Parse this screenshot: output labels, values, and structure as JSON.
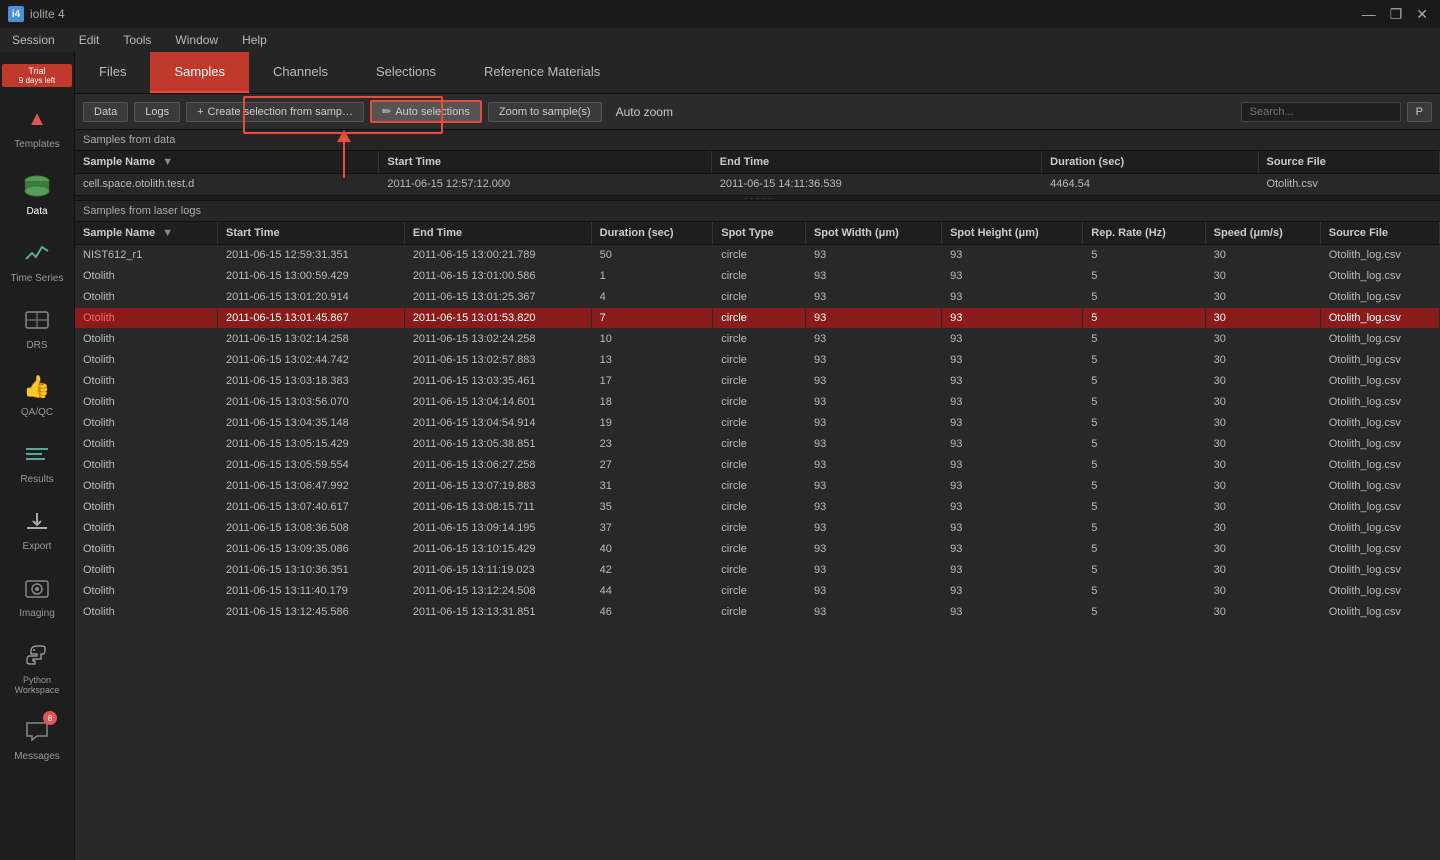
{
  "app": {
    "title": "iolite 4",
    "icon": "i4"
  },
  "titlebar": {
    "controls": [
      "—",
      "❐",
      "✕"
    ]
  },
  "menubar": {
    "items": [
      "Session",
      "Edit",
      "Tools",
      "Window",
      "Help"
    ]
  },
  "trial": {
    "label": "Trial",
    "days_left": "9 days left"
  },
  "sidebar": {
    "items": [
      {
        "id": "templates",
        "label": "Templates",
        "icon": "▲"
      },
      {
        "id": "data",
        "label": "Data",
        "icon": "db"
      },
      {
        "id": "time-series",
        "label": "Time Series",
        "icon": "ts"
      },
      {
        "id": "drs",
        "label": "DRS",
        "icon": "drs"
      },
      {
        "id": "qa-qc",
        "label": "QA/QC",
        "icon": "qa"
      },
      {
        "id": "results",
        "label": "Results",
        "icon": "res"
      },
      {
        "id": "export",
        "label": "Export",
        "icon": "exp"
      },
      {
        "id": "imaging",
        "label": "Imaging",
        "icon": "img"
      },
      {
        "id": "python",
        "label": "Python Workspace",
        "icon": "py"
      },
      {
        "id": "messages",
        "label": "Messages",
        "icon": "msg",
        "badge": "8"
      }
    ]
  },
  "top_nav": {
    "tabs": [
      {
        "id": "files",
        "label": "Files",
        "active": false
      },
      {
        "id": "samples",
        "label": "Samples",
        "active": true
      },
      {
        "id": "channels",
        "label": "Channels",
        "active": false
      },
      {
        "id": "selections",
        "label": "Selections",
        "active": false
      },
      {
        "id": "reference-materials",
        "label": "Reference Materials",
        "active": false
      }
    ]
  },
  "toolbar": {
    "data_btn": "Data",
    "logs_btn": "Logs",
    "create_selection_btn": "Create selection from samp…",
    "auto_selections_btn": "Auto selections",
    "zoom_to_sample_btn": "Zoom to sample(s)",
    "auto_zoom_label": "Auto zoom",
    "search_placeholder": "Search...",
    "p_btn": "P"
  },
  "samples_from_data": {
    "section_label": "Samples from data",
    "columns": [
      "Sample Name",
      "Start Time",
      "End Time",
      "Duration (sec)",
      "Source File"
    ],
    "rows": [
      {
        "sample_name": "cell.space.otolith.test.d",
        "start_time": "2011-06-15 12:57:12.000",
        "end_time": "2011-06-15 14:11:36.539",
        "duration": "4464.54",
        "source_file": "Otolith.csv"
      }
    ]
  },
  "samples_from_laser_logs": {
    "section_label": "Samples from laser logs",
    "columns": [
      "Sample Name",
      "Start Time",
      "End Time",
      "Duration (sec)",
      "Spot Type",
      "Spot Width (μm)",
      "Spot Height (μm)",
      "Rep. Rate (Hz)",
      "Speed (μm/s)",
      "Source File"
    ],
    "rows": [
      {
        "name": "NIST612_r1",
        "start": "2011-06-15 12:59:31.351",
        "end": "2011-06-15 13:00:21.789",
        "dur": "50",
        "type": "circle",
        "sw": "93",
        "sh": "93",
        "rr": "5",
        "sp": "30",
        "src": "Otolith_log.csv",
        "selected": false
      },
      {
        "name": "Otolith",
        "start": "2011-06-15 13:00:59.429",
        "end": "2011-06-15 13:01:00.586",
        "dur": "1",
        "type": "circle",
        "sw": "93",
        "sh": "93",
        "rr": "5",
        "sp": "30",
        "src": "Otolith_log.csv",
        "selected": false
      },
      {
        "name": "Otolith",
        "start": "2011-06-15 13:01:20.914",
        "end": "2011-06-15 13:01:25.367",
        "dur": "4",
        "type": "circle",
        "sw": "93",
        "sh": "93",
        "rr": "5",
        "sp": "30",
        "src": "Otolith_log.csv",
        "selected": false
      },
      {
        "name": "Otolith",
        "start": "2011-06-15 13:01:45.867",
        "end": "2011-06-15 13:01:53.820",
        "dur": "7",
        "type": "circle",
        "sw": "93",
        "sh": "93",
        "rr": "5",
        "sp": "30",
        "src": "Otolith_log.csv",
        "selected": true
      },
      {
        "name": "Otolith",
        "start": "2011-06-15 13:02:14.258",
        "end": "2011-06-15 13:02:24.258",
        "dur": "10",
        "type": "circle",
        "sw": "93",
        "sh": "93",
        "rr": "5",
        "sp": "30",
        "src": "Otolith_log.csv",
        "selected": false
      },
      {
        "name": "Otolith",
        "start": "2011-06-15 13:02:44.742",
        "end": "2011-06-15 13:02:57.883",
        "dur": "13",
        "type": "circle",
        "sw": "93",
        "sh": "93",
        "rr": "5",
        "sp": "30",
        "src": "Otolith_log.csv",
        "selected": false
      },
      {
        "name": "Otolith",
        "start": "2011-06-15 13:03:18.383",
        "end": "2011-06-15 13:03:35.461",
        "dur": "17",
        "type": "circle",
        "sw": "93",
        "sh": "93",
        "rr": "5",
        "sp": "30",
        "src": "Otolith_log.csv",
        "selected": false
      },
      {
        "name": "Otolith",
        "start": "2011-06-15 13:03:56.070",
        "end": "2011-06-15 13:04:14.601",
        "dur": "18",
        "type": "circle",
        "sw": "93",
        "sh": "93",
        "rr": "5",
        "sp": "30",
        "src": "Otolith_log.csv",
        "selected": false
      },
      {
        "name": "Otolith",
        "start": "2011-06-15 13:04:35.148",
        "end": "2011-06-15 13:04:54.914",
        "dur": "19",
        "type": "circle",
        "sw": "93",
        "sh": "93",
        "rr": "5",
        "sp": "30",
        "src": "Otolith_log.csv",
        "selected": false
      },
      {
        "name": "Otolith",
        "start": "2011-06-15 13:05:15.429",
        "end": "2011-06-15 13:05:38.851",
        "dur": "23",
        "type": "circle",
        "sw": "93",
        "sh": "93",
        "rr": "5",
        "sp": "30",
        "src": "Otolith_log.csv",
        "selected": false
      },
      {
        "name": "Otolith",
        "start": "2011-06-15 13:05:59.554",
        "end": "2011-06-15 13:06:27.258",
        "dur": "27",
        "type": "circle",
        "sw": "93",
        "sh": "93",
        "rr": "5",
        "sp": "30",
        "src": "Otolith_log.csv",
        "selected": false
      },
      {
        "name": "Otolith",
        "start": "2011-06-15 13:06:47.992",
        "end": "2011-06-15 13:07:19.883",
        "dur": "31",
        "type": "circle",
        "sw": "93",
        "sh": "93",
        "rr": "5",
        "sp": "30",
        "src": "Otolith_log.csv",
        "selected": false
      },
      {
        "name": "Otolith",
        "start": "2011-06-15 13:07:40.617",
        "end": "2011-06-15 13:08:15.711",
        "dur": "35",
        "type": "circle",
        "sw": "93",
        "sh": "93",
        "rr": "5",
        "sp": "30",
        "src": "Otolith_log.csv",
        "selected": false
      },
      {
        "name": "Otolith",
        "start": "2011-06-15 13:08:36.508",
        "end": "2011-06-15 13:09:14.195",
        "dur": "37",
        "type": "circle",
        "sw": "93",
        "sh": "93",
        "rr": "5",
        "sp": "30",
        "src": "Otolith_log.csv",
        "selected": false
      },
      {
        "name": "Otolith",
        "start": "2011-06-15 13:09:35.086",
        "end": "2011-06-15 13:10:15.429",
        "dur": "40",
        "type": "circle",
        "sw": "93",
        "sh": "93",
        "rr": "5",
        "sp": "30",
        "src": "Otolith_log.csv",
        "selected": false
      },
      {
        "name": "Otolith",
        "start": "2011-06-15 13:10:36.351",
        "end": "2011-06-15 13:11:19.023",
        "dur": "42",
        "type": "circle",
        "sw": "93",
        "sh": "93",
        "rr": "5",
        "sp": "30",
        "src": "Otolith_log.csv",
        "selected": false
      },
      {
        "name": "Otolith",
        "start": "2011-06-15 13:11:40.179",
        "end": "2011-06-15 13:12:24.508",
        "dur": "44",
        "type": "circle",
        "sw": "93",
        "sh": "93",
        "rr": "5",
        "sp": "30",
        "src": "Otolith_log.csv",
        "selected": false
      },
      {
        "name": "Otolith",
        "start": "2011-06-15 13:12:45.586",
        "end": "2011-06-15 13:13:31.851",
        "dur": "46",
        "type": "circle",
        "sw": "93",
        "sh": "93",
        "rr": "5",
        "sp": "30",
        "src": "Otolith_log.csv",
        "selected": false
      }
    ]
  }
}
